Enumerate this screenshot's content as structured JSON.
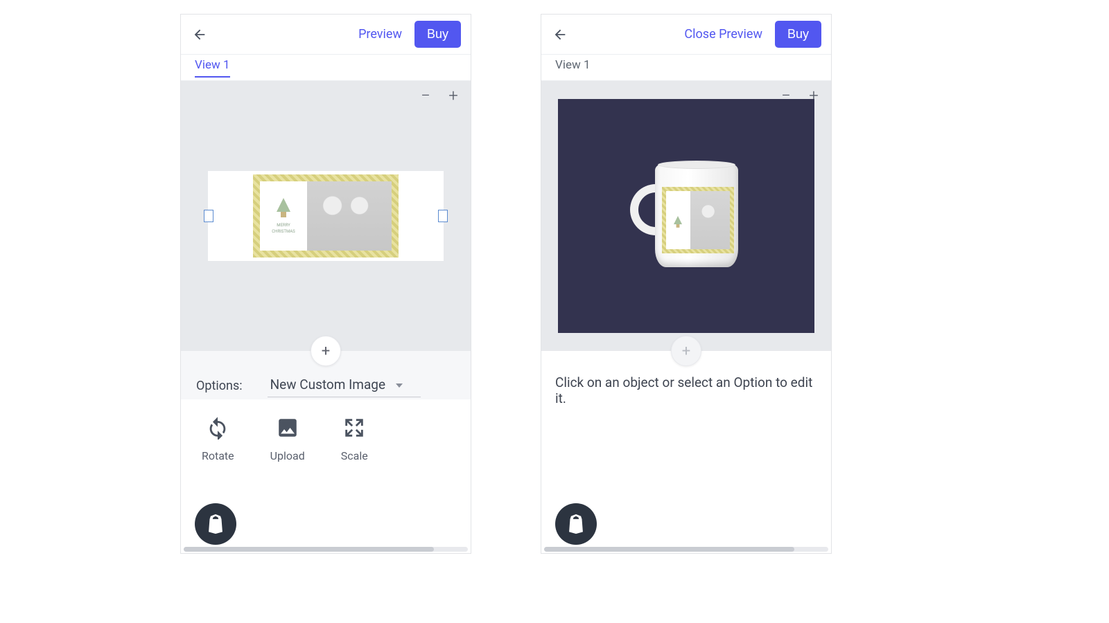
{
  "accent_color": "#5257f0",
  "left": {
    "header": {
      "preview_link": "Preview",
      "buy_button": "Buy"
    },
    "tab_label": "View 1",
    "options_label": "Options:",
    "options_selected": "New Custom Image",
    "tools": {
      "rotate": "Rotate",
      "upload": "Upload",
      "scale": "Scale"
    },
    "add_button": "+",
    "zoom_minus": "−",
    "zoom_plus": "+",
    "design_caption_line1": "MERRY",
    "design_caption_line2": "CHRISTMAS"
  },
  "right": {
    "header": {
      "close_link": "Close Preview",
      "buy_button": "Buy"
    },
    "tab_label": "View 1",
    "hint": "Click on an object or select an Option to edit it.",
    "add_button": "+",
    "zoom_minus": "−",
    "zoom_plus": "+"
  },
  "shopify_badge": "S"
}
